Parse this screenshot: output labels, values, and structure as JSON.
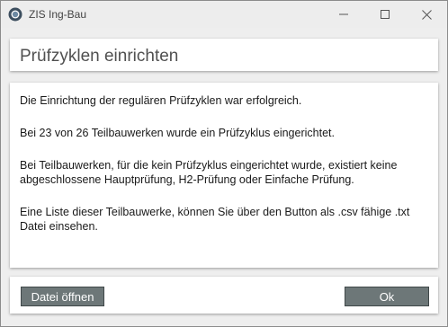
{
  "window": {
    "title": "ZIS Ing-Bau",
    "app_icon": "circle-app-icon",
    "controls": {
      "minimize_icon": "minimize-icon",
      "maximize_icon": "maximize-icon",
      "close_icon": "close-icon"
    }
  },
  "dialog": {
    "heading": "Prüfzyklen einrichten",
    "messages": [
      "Die Einrichtung der regulären Prüfzyklen war erfolgreich.",
      "Bei 23 von 26 Teilbauwerken wurde ein Prüfzyklus eingerichtet.",
      "Bei Teilbauwerken, für die kein Prüfzyklus eingerichtet wurde, existiert keine abgeschlossene Hauptprüfung, H2-Prüfung oder Einfache Prüfung.",
      "Eine Liste dieser Teilbauwerke, können Sie über den Button als .csv fähige .txt Datei einsehen."
    ]
  },
  "footer": {
    "open_file_label": "Datei öffnen",
    "ok_label": "Ok"
  },
  "colors": {
    "window_background": "#eeeeee",
    "panel_background": "#ffffff",
    "button_background": "#6d7778",
    "button_text": "#ffffff",
    "heading_text": "#505050"
  }
}
